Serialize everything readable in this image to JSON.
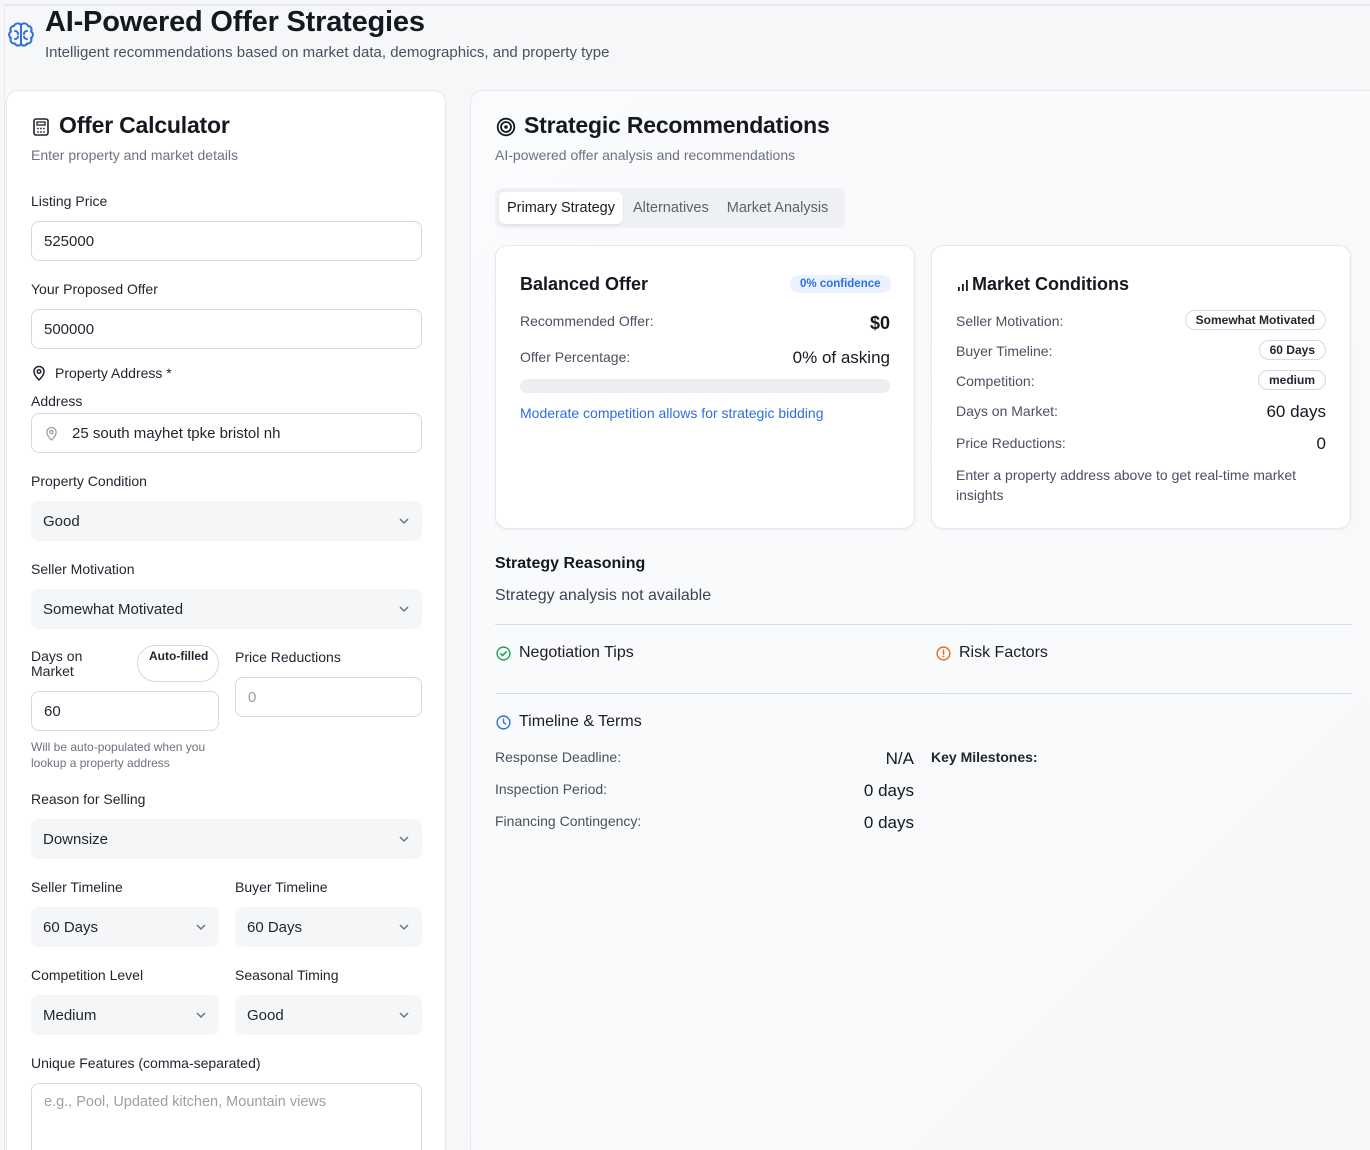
{
  "header": {
    "title": "AI-Powered Offer Strategies",
    "subtitle": "Intelligent recommendations based on market data, demographics, and property type"
  },
  "calculator": {
    "title": "Offer Calculator",
    "subtitle": "Enter property and market details",
    "listing_price": {
      "label": "Listing Price",
      "value": "525000"
    },
    "proposed_offer": {
      "label": "Your Proposed Offer",
      "value": "500000"
    },
    "property_address": {
      "section_label": "Property Address *",
      "label": "Address",
      "value": "25 south mayhet tpke bristol nh"
    },
    "property_condition": {
      "label": "Property Condition",
      "value": "Good"
    },
    "seller_motivation": {
      "label": "Seller Motivation",
      "value": "Somewhat Motivated"
    },
    "days_on_market": {
      "label": "Days on Market",
      "badge": "Auto-filled",
      "value": "60",
      "hint": "Will be auto-populated when you lookup a property address"
    },
    "price_reductions": {
      "label": "Price Reductions",
      "placeholder": "0"
    },
    "reason_for_selling": {
      "label": "Reason for Selling",
      "value": "Downsize"
    },
    "seller_timeline": {
      "label": "Seller Timeline",
      "value": "60 Days"
    },
    "buyer_timeline": {
      "label": "Buyer Timeline",
      "value": "60 Days"
    },
    "competition_level": {
      "label": "Competition Level",
      "value": "Medium"
    },
    "seasonal_timing": {
      "label": "Seasonal Timing",
      "value": "Good"
    },
    "unique_features": {
      "label": "Unique Features (comma-separated)",
      "placeholder": "e.g., Pool, Updated kitchen, Mountain views"
    }
  },
  "recommendations": {
    "title": "Strategic Recommendations",
    "subtitle": "AI-powered offer analysis and recommendations",
    "tabs": [
      "Primary Strategy",
      "Alternatives",
      "Market Analysis"
    ],
    "active_tab": "Primary Strategy",
    "offer_card": {
      "title": "Balanced Offer",
      "confidence": "0% confidence",
      "recommended_label": "Recommended Offer:",
      "recommended_value": "$0",
      "percentage_label": "Offer Percentage:",
      "percentage_value": "0% of asking",
      "progress_fraction": 0,
      "note": "Moderate competition allows for strategic bidding"
    },
    "market_card": {
      "title": "Market Conditions",
      "seller_motivation_label": "Seller Motivation:",
      "seller_motivation_value": "Somewhat Motivated",
      "buyer_timeline_label": "Buyer Timeline:",
      "buyer_timeline_value": "60 Days",
      "competition_label": "Competition:",
      "competition_value": "medium",
      "days_label": "Days on Market:",
      "days_value": "60 days",
      "reductions_label": "Price Reductions:",
      "reductions_value": "0",
      "note": "Enter a property address above to get real-time market insights"
    },
    "reasoning": {
      "title": "Strategy Reasoning",
      "text": "Strategy analysis not available"
    },
    "negotiation_tips": "Negotiation Tips",
    "risk_factors": "Risk Factors",
    "timeline": {
      "title": "Timeline & Terms",
      "response_label": "Response Deadline:",
      "response_value": "N/A",
      "inspection_label": "Inspection Period:",
      "inspection_value": "0 days",
      "financing_label": "Financing Contingency:",
      "financing_value": "0 days",
      "milestones_label": "Key Milestones:"
    }
  },
  "colors": {
    "accent": "#2f6fdb",
    "success": "#22a05a",
    "warning": "#e0731f"
  }
}
